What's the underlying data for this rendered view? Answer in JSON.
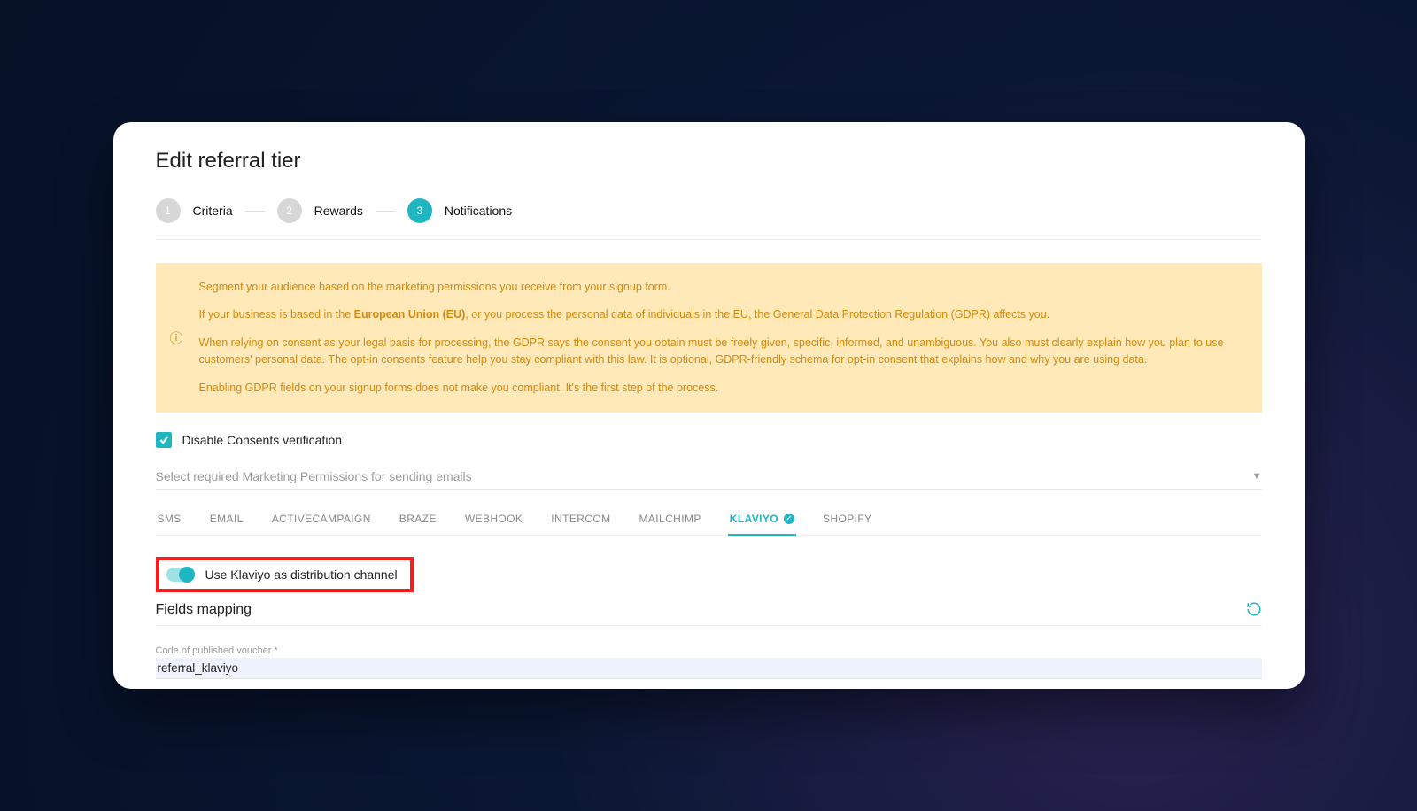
{
  "page": {
    "title": "Edit referral tier"
  },
  "stepper": {
    "steps": [
      {
        "num": "1",
        "label": "Criteria"
      },
      {
        "num": "2",
        "label": "Rewards"
      },
      {
        "num": "3",
        "label": "Notifications"
      }
    ],
    "activeIndex": 2
  },
  "alert": {
    "p1": "Segment your audience based on the marketing permissions you receive from your signup form.",
    "p2_prefix": "If your business is based in the ",
    "p2_bold": "European Union (EU)",
    "p2_suffix": ", or you process the personal data of individuals in the EU, the General Data Protection Regulation (GDPR) affects you.",
    "p3": "When relying on consent as your legal basis for processing, the GDPR says the consent you obtain must be freely given, specific, informed, and unambiguous. You also must clearly explain how you plan to use customers' personal data. The opt-in consents feature help you stay compliant with this law. It is optional, GDPR-friendly schema for opt-in consent that explains how and why you are using data.",
    "p4": "Enabling GDPR fields on your signup forms does not make you compliant. It's the first step of the process."
  },
  "consent": {
    "checkboxLabel": "Disable Consents verification"
  },
  "select": {
    "placeholder": "Select required Marketing Permissions for sending emails"
  },
  "tabs": {
    "items": [
      {
        "label": "SMS"
      },
      {
        "label": "EMAIL"
      },
      {
        "label": "ACTIVECAMPAIGN"
      },
      {
        "label": "BRAZE"
      },
      {
        "label": "WEBHOOK"
      },
      {
        "label": "INTERCOM"
      },
      {
        "label": "MAILCHIMP"
      },
      {
        "label": "KLAVIYO"
      },
      {
        "label": "SHOPIFY"
      }
    ],
    "activeIndex": 7
  },
  "toggle": {
    "label": "Use Klaviyo as distribution channel"
  },
  "fieldsMapping": {
    "heading": "Fields mapping",
    "field1": {
      "label": "Code of published voucher *",
      "value": "referral_klaviyo"
    }
  }
}
